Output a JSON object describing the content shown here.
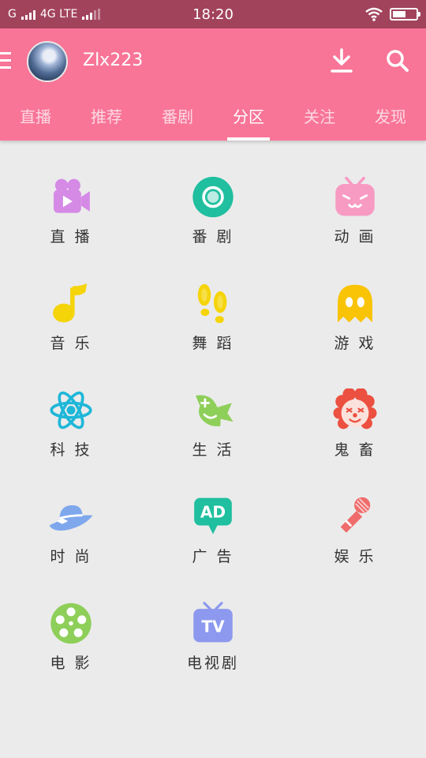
{
  "status_bar": {
    "carrier": "G",
    "network": "4G LTE",
    "time": "18:20"
  },
  "header": {
    "username": "Zlx223",
    "icons": {
      "menu": "menu-icon",
      "avatar": "avatar",
      "download": "download-icon",
      "search": "search-icon"
    }
  },
  "tabs": [
    {
      "label": "直播"
    },
    {
      "label": "推荐"
    },
    {
      "label": "番剧"
    },
    {
      "label": "分区",
      "active": true
    },
    {
      "label": "关注"
    },
    {
      "label": "发现"
    }
  ],
  "categories": [
    {
      "label": "直 播",
      "icon": "camera-icon",
      "color": "#d58ae6"
    },
    {
      "label": "番 剧",
      "icon": "target-icon",
      "color": "#1fbf9f"
    },
    {
      "label": "动 画",
      "icon": "tv-face-icon",
      "color": "#f79bc3"
    },
    {
      "label": "音 乐",
      "icon": "music-note-icon",
      "color": "#f5d40a"
    },
    {
      "label": "舞 蹈",
      "icon": "footprint-icon",
      "color": "#f5d40a"
    },
    {
      "label": "游 戏",
      "icon": "ghost-icon",
      "color": "#f9c306"
    },
    {
      "label": "科 技",
      "icon": "atom-icon",
      "color": "#1fb7d9"
    },
    {
      "label": "生 活",
      "icon": "fish-icon",
      "color": "#8ecf5a"
    },
    {
      "label": "鬼 畜",
      "icon": "clown-icon",
      "color": "#ec5040"
    },
    {
      "label": "时 尚",
      "icon": "hat-icon",
      "color": "#7ea7ec"
    },
    {
      "label": "广 告",
      "icon": "ad-icon",
      "color": "#1fbf9f"
    },
    {
      "label": "娱 乐",
      "icon": "microphone-icon",
      "color": "#f06b6b"
    },
    {
      "label": "电 影",
      "icon": "film-reel-icon",
      "color": "#8ecf5a"
    },
    {
      "label": "电视剧",
      "icon": "tv-icon",
      "color": "#8d99ee"
    }
  ]
}
